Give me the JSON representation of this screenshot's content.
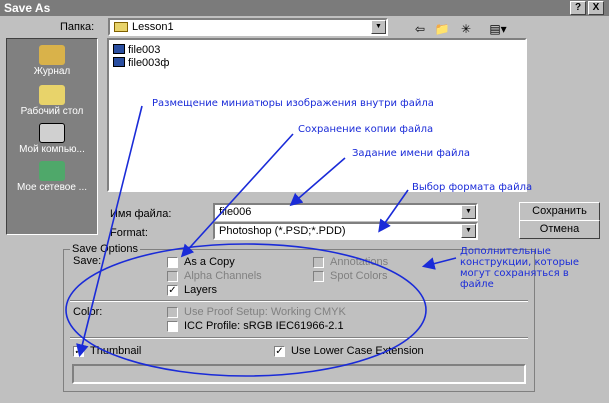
{
  "window": {
    "title": "Save As",
    "help_label": "?",
    "close_label": "X"
  },
  "lookin": {
    "label": "Папка:",
    "value": "Lesson1"
  },
  "places": [
    {
      "label": "Журнал",
      "icon": "history-icon"
    },
    {
      "label": "Рабочий стол",
      "icon": "desktop-icon"
    },
    {
      "label": "Мой компью...",
      "icon": "my-computer-icon"
    },
    {
      "label": "Мое сетевое ...",
      "icon": "network-icon"
    }
  ],
  "files": [
    "file003",
    "file003ф"
  ],
  "filename": {
    "label": "Имя файла:",
    "value": "file006"
  },
  "format": {
    "label": "Format:",
    "value": "Photoshop (*.PSD;*.PDD)"
  },
  "buttons": {
    "save": "Сохранить",
    "cancel": "Отмена"
  },
  "options": {
    "legend": "Save Options",
    "save_label": "Save:",
    "as_copy": {
      "label": "As a Copy",
      "checked": false
    },
    "alpha_channels": {
      "label": "Alpha Channels",
      "checked": false,
      "disabled": true
    },
    "layers": {
      "label": "Layers",
      "checked": true
    },
    "annotations": {
      "label": "Annotations",
      "checked": false,
      "disabled": true
    },
    "spot_colors": {
      "label": "Spot Colors",
      "checked": false,
      "disabled": true
    },
    "color_label": "Color:",
    "proof_setup": {
      "label": "Use Proof Setup:  Working CMYK",
      "checked": false,
      "disabled": true
    },
    "icc_profile": {
      "label": "ICC Profile:  sRGB IEC61966-2.1",
      "checked": false
    },
    "thumbnail": {
      "label": "Thumbnail",
      "checked": true
    },
    "lower_case": {
      "label": "Use Lower Case Extension",
      "checked": true
    }
  },
  "annotations": {
    "thumbnail_note": "Размещение миниатюры изображения внутри файла",
    "copy_note": "Сохранение копии файла",
    "name_note": "Задание имени файла",
    "format_note": "Выбор формата файла",
    "extra_note": "Дополнительные конструкции, которые могут сохраняться в файле"
  },
  "colors": {
    "annotation": "#1a2bd8",
    "dialog": "#c0c0c0",
    "titlebar": "#7b7b7b"
  }
}
